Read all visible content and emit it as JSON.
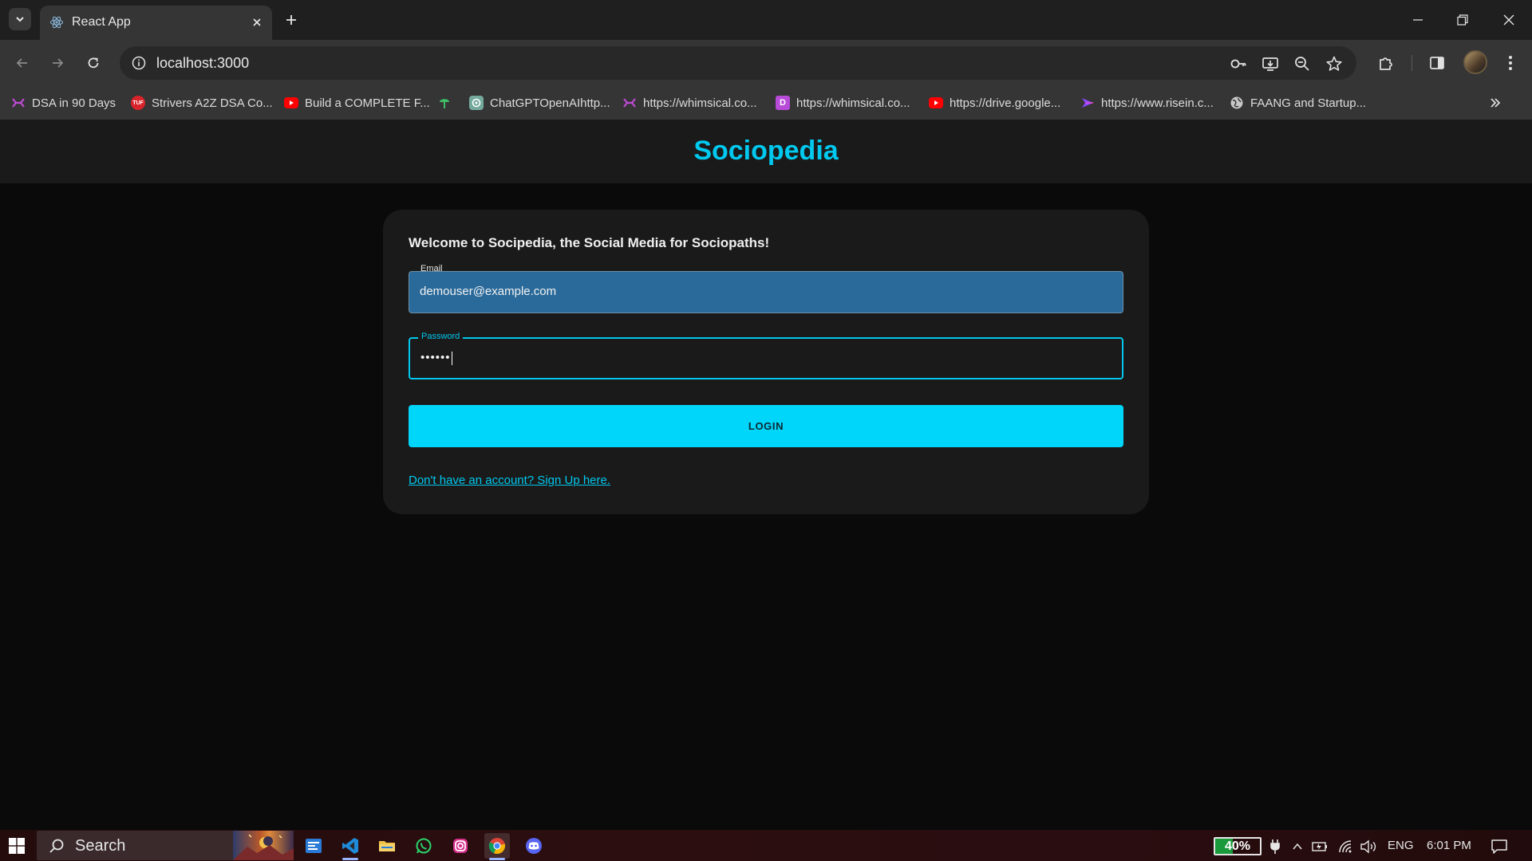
{
  "browser": {
    "tab_title": "React App",
    "url": "localhost:3000",
    "bookmarks": [
      {
        "label": "DSA in 90 Days",
        "icon": "whimsical-icon",
        "color": "#c04ad8"
      },
      {
        "label": "Strivers A2Z DSA Co...",
        "icon": "tuf-icon",
        "color": "#d8232a"
      },
      {
        "label": "Build a COMPLETE F...",
        "icon": "youtube-icon",
        "color": "#ff0000"
      },
      {
        "label": "",
        "icon": "leaf-icon",
        "color": "#3fbf6a"
      },
      {
        "label": "ChatGPTOpenAIhttp...",
        "icon": "openai-icon",
        "color": "#74aa9c"
      },
      {
        "label": "https://whimsical.co...",
        "icon": "whimsical-icon",
        "color": "#c04ad8"
      },
      {
        "label": "https://whimsical.co...",
        "icon": "doc-icon",
        "color": "#b84ad8"
      },
      {
        "label": "https://drive.google...",
        "icon": "youtube-icon",
        "color": "#ff0000"
      },
      {
        "label": "https://www.risein.c...",
        "icon": "risein-icon",
        "color": "#8a4aff"
      },
      {
        "label": "FAANG and Startup...",
        "icon": "globe-icon",
        "color": "#c8c8c8"
      }
    ]
  },
  "page": {
    "brand": "Sociopedia",
    "welcome": "Welcome to Socipedia, the Social Media for Sociopaths!",
    "email": {
      "label": "Email",
      "value": "demouser@example.com"
    },
    "password": {
      "label": "Password",
      "masked_value": "••••••"
    },
    "login_label": "LOGIN",
    "signup_link": "Don't have an account? Sign Up here."
  },
  "taskbar": {
    "search_label": "Search",
    "battery_percent": "40%",
    "language": "ENG",
    "time": "6:01 PM"
  },
  "colors": {
    "accent": "#00c8ee",
    "login_button": "#00d5fa",
    "email_fill": "#2a6a9a"
  }
}
